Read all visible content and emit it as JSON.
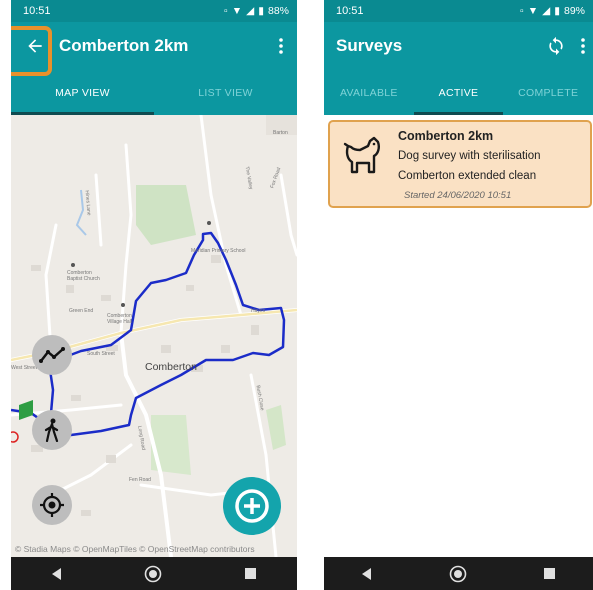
{
  "left": {
    "status": {
      "time": "10:51",
      "battery": "88%",
      "network": "4G"
    },
    "toolbar": {
      "title": "Comberton 2km",
      "back_icon": "arrow-back-icon",
      "menu_icon": "more-vert-icon"
    },
    "tabs": [
      {
        "label": "MAP VIEW",
        "active": true
      },
      {
        "label": "LIST VIEW",
        "active": false
      }
    ],
    "map": {
      "place_labels": {
        "village": "Comberton",
        "school": "Meridian Primary School",
        "church": "Comberton Baptist Church",
        "hall": "Comberton Village Hall",
        "green_end": "Green End",
        "south_street": "South Street",
        "long_road": "Long Road",
        "the_valley": "The Valley",
        "fox_road": "Fox Road",
        "hayes": "Hayes",
        "barton": "Barton",
        "bush_close": "Bush Close",
        "north_ln": "Hines Lane",
        "fen_lane": "Fen Road",
        "west_road": "West Street"
      },
      "attribution": "© Stadia Maps © OpenMapTiles © OpenStreetMap contributors"
    },
    "buttons": {
      "route_icon": "route-icon",
      "walk_icon": "walking-person-icon",
      "location_icon": "my-location-icon",
      "add_icon": "add-circle-icon"
    }
  },
  "right": {
    "status": {
      "time": "10:51",
      "battery": "89%",
      "network": "4G"
    },
    "toolbar": {
      "title": "Surveys",
      "sync_icon": "sync-icon",
      "menu_icon": "more-vert-icon"
    },
    "tabs": [
      {
        "label": "AVAILABLE",
        "active": false
      },
      {
        "label": "ACTIVE",
        "active": true
      },
      {
        "label": "COMPLETE",
        "active": false
      }
    ],
    "survey_card": {
      "title": "Comberton 2km",
      "line1": "Dog survey with sterilisation",
      "line2": "Comberton extended clean",
      "started": "Started 24/06/2020 10:51",
      "icon": "dog-icon"
    }
  },
  "colors": {
    "primary": "#0c97a0",
    "accent": "#14a4ac",
    "card_bg": "#fae1c4",
    "card_border": "#e0a24e",
    "highlight": "#e8912b",
    "route": "#1b2cc8"
  }
}
